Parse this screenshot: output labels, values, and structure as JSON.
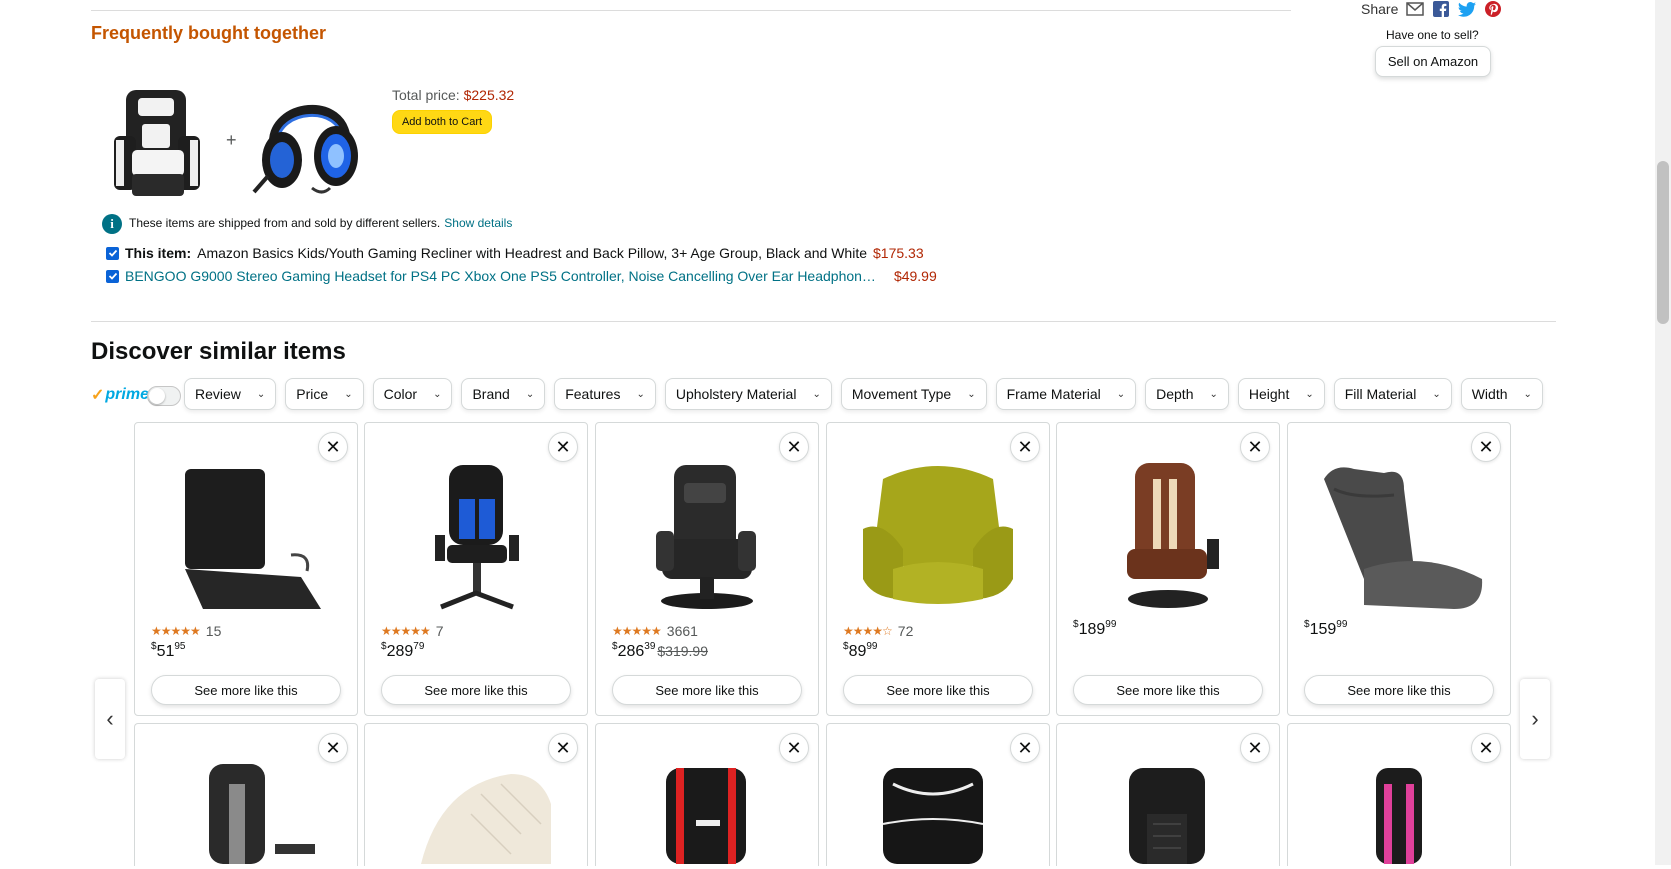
{
  "share": {
    "label": "Share",
    "have_one": "Have one to sell?",
    "sell_button": "Sell on Amazon"
  },
  "fbt": {
    "title": "Frequently bought together",
    "plus": "+",
    "total_label": "Total price:",
    "total_price": "$225.32",
    "add_both": "Add both to Cart",
    "info_text": "These items are shipped from and sold by different sellers.",
    "show_details": "Show details",
    "items": [
      {
        "prefix": "This item:",
        "name": "Amazon Basics Kids/Youth Gaming Recliner with Headrest and Back Pillow, 3+ Age Group, Black and White",
        "price": "$175.33"
      },
      {
        "prefix": "",
        "name": "BENGOO G9000 Stereo Gaming Headset for PS4 PC Xbox One PS5 Controller, Noise Cancelling Over Ear Headphon…",
        "price": "$49.99"
      }
    ]
  },
  "discover": {
    "title": "Discover similar items",
    "prime_label": "prime",
    "filters": [
      "Review",
      "Price",
      "Color",
      "Brand",
      "Features",
      "Upholstery Material",
      "Movement Type",
      "Frame Material",
      "Depth",
      "Height",
      "Fill Material",
      "Width"
    ],
    "see_more": "See more like this",
    "close_glyph": "✕",
    "cards_row1": [
      {
        "rating_count": "15",
        "stars": "★★★★★",
        "price_whole": "51",
        "price_frac": "95",
        "old_price": ""
      },
      {
        "rating_count": "7",
        "stars": "★★★★★",
        "price_whole": "289",
        "price_frac": "79",
        "old_price": ""
      },
      {
        "rating_count": "3661",
        "stars": "★★★★★",
        "price_whole": "286",
        "price_frac": "39",
        "old_price": "$319.99"
      },
      {
        "rating_count": "72",
        "stars": "★★★★☆",
        "price_whole": "89",
        "price_frac": "99",
        "old_price": ""
      },
      {
        "rating_count": "",
        "stars": "",
        "price_whole": "189",
        "price_frac": "99",
        "old_price": ""
      },
      {
        "rating_count": "",
        "stars": "",
        "price_whole": "159",
        "price_frac": "99",
        "old_price": ""
      }
    ],
    "nav_prev": "‹",
    "nav_next": "›"
  }
}
